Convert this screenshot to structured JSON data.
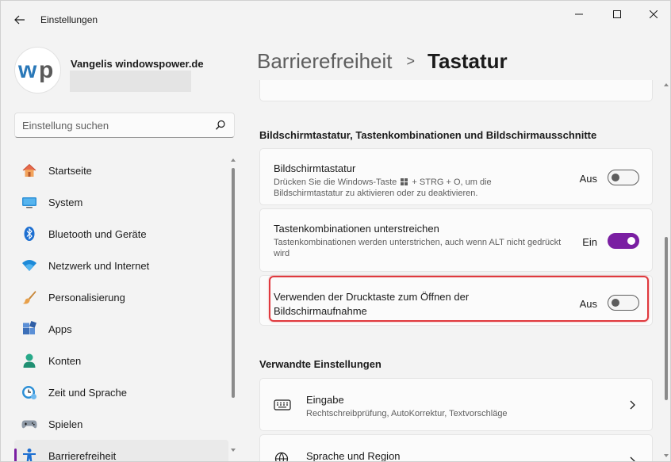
{
  "window": {
    "title": "Einstellungen"
  },
  "profile": {
    "name": "Vangelis windowspower.de",
    "logo_text": "wp"
  },
  "search": {
    "placeholder": "Einstellung suchen"
  },
  "sidebar": {
    "items": [
      {
        "label": "Startseite",
        "icon": "home-icon"
      },
      {
        "label": "System",
        "icon": "system-icon"
      },
      {
        "label": "Bluetooth und Geräte",
        "icon": "bluetooth-icon"
      },
      {
        "label": "Netzwerk und Internet",
        "icon": "wifi-icon"
      },
      {
        "label": "Personalisierung",
        "icon": "brush-icon"
      },
      {
        "label": "Apps",
        "icon": "apps-icon"
      },
      {
        "label": "Konten",
        "icon": "account-icon"
      },
      {
        "label": "Zeit und Sprache",
        "icon": "clock-globe-icon"
      },
      {
        "label": "Spielen",
        "icon": "gamepad-icon"
      },
      {
        "label": "Barrierefreiheit",
        "icon": "accessibility-icon",
        "active": true
      }
    ]
  },
  "breadcrumb": {
    "parent": "Barrierefreiheit",
    "separator": ">",
    "current": "Tastatur"
  },
  "section_keyboard": {
    "heading": "Bildschirmtastatur, Tastenkombinationen und Bildschirmausschnitte",
    "settings": [
      {
        "title": "Bildschirmtastatur",
        "description_before": "Drücken Sie die Windows-Taste",
        "description_after": "+ STRG + O, um die Bildschirmtastatur zu aktivieren oder zu deaktivieren.",
        "state_label": "Aus",
        "on": false
      },
      {
        "title": "Tastenkombinationen unterstreichen",
        "description": "Tastenkombinationen werden unterstrichen, auch wenn ALT nicht gedrückt wird",
        "state_label": "Ein",
        "on": true
      },
      {
        "title": "Verwenden der Drucktaste zum Öffnen der Bildschirmaufnahme",
        "state_label": "Aus",
        "on": false
      }
    ]
  },
  "section_related": {
    "heading": "Verwandte Einstellungen",
    "items": [
      {
        "title": "Eingabe",
        "description": "Rechtschreibprüfung, AutoKorrektur, Textvorschläge",
        "icon": "keyboard-icon"
      },
      {
        "title": "Sprache und Region",
        "icon": "language-globe-icon"
      }
    ]
  },
  "colors": {
    "accent": "#7a1fa2",
    "highlight_border": "#e0393e",
    "background": "#f3f3f3",
    "card": "#fbfbfb"
  }
}
